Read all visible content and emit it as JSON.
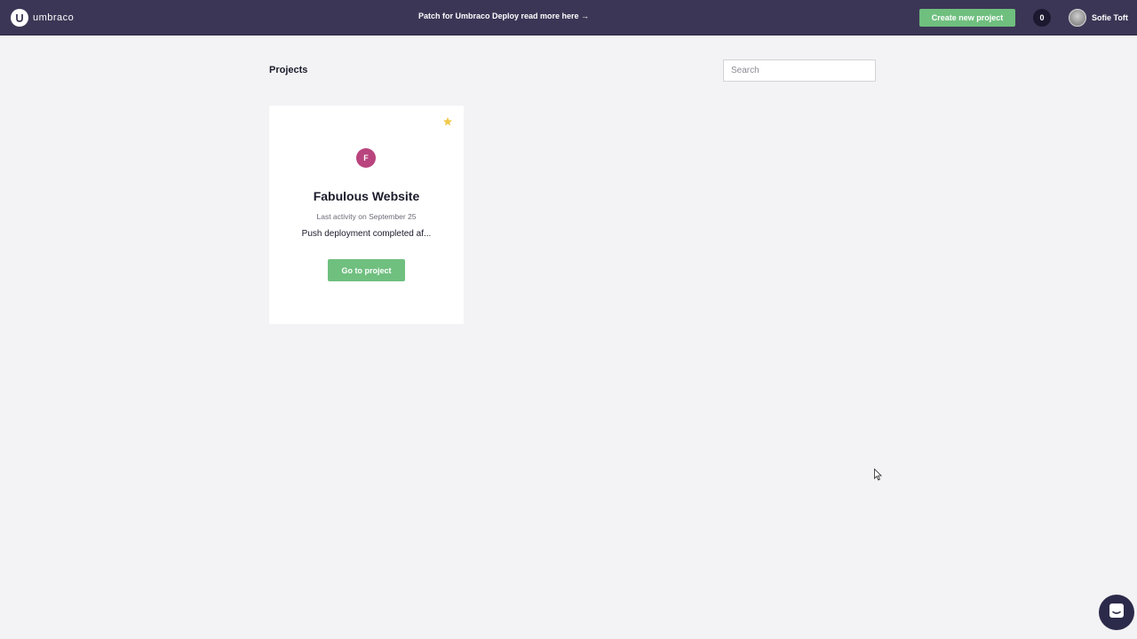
{
  "header": {
    "logo_text": "umbraco",
    "announcement": "Patch for Umbraco Deploy read more here →",
    "create_button": "Create new project",
    "notification_count": "0",
    "user_name": "Sofie Toft"
  },
  "main": {
    "title": "Projects",
    "search": {
      "placeholder": "Search",
      "value": ""
    }
  },
  "projects": [
    {
      "initial": "F",
      "name": "Fabulous Website",
      "last_activity": "Last activity on September 25",
      "status": "Push deployment completed af...",
      "button_label": "Go to project",
      "favorite": true,
      "icon_color": "#b9447e"
    }
  ],
  "colors": {
    "topbar": "#3c3656",
    "accent_green": "#6fbf7f",
    "star": "#f2c94c",
    "background": "#f3f3f5"
  },
  "icons": [
    "umbraco-logo-icon",
    "star-icon",
    "chat-icon",
    "cursor-icon"
  ]
}
